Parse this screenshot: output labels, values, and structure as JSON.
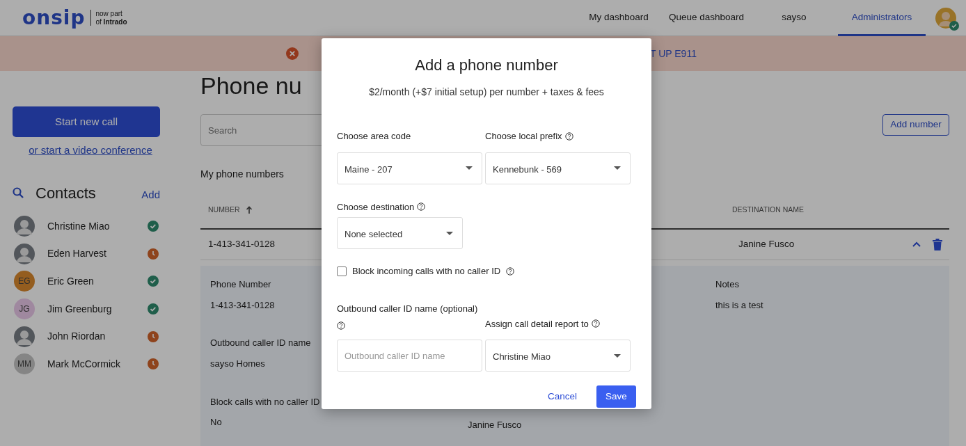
{
  "header": {
    "logo": "onsip",
    "tagline": [
      "now part",
      "of **Intrado**"
    ],
    "nav": [
      {
        "label": "My dashboard",
        "selected": false
      },
      {
        "label": "Queue dashboard",
        "selected": false
      },
      {
        "label": "sayso",
        "selected": false
      },
      {
        "label": "Administrators",
        "selected": true
      }
    ],
    "user_available": true
  },
  "banner": {
    "link": "T UP E911"
  },
  "sidebar": {
    "start_call": "Start new call",
    "video_link": "or start a video conference",
    "contacts_title": "Contacts",
    "add": "Add",
    "contacts": [
      {
        "name": "Christine Miao",
        "avatar": {
          "kind": "photo"
        },
        "available": true
      },
      {
        "name": "Eden Harvest",
        "avatar": {
          "kind": "photo"
        },
        "available": false
      },
      {
        "name": "Eric Green",
        "avatar": {
          "kind": "initials",
          "text": "EG",
          "color": "#945e20"
        },
        "available": true
      },
      {
        "name": "Jim Greenburg",
        "avatar": {
          "kind": "initials",
          "text": "JG",
          "color": "#a0899f"
        },
        "available": true
      },
      {
        "name": "John Riordan",
        "avatar": {
          "kind": "photo"
        },
        "available": false
      },
      {
        "name": "Mark McCormick",
        "avatar": {
          "kind": "initials",
          "text": "MM",
          "color": "#858585"
        },
        "available": false
      }
    ]
  },
  "main": {
    "title": "Phone nu",
    "search": {
      "placeholder": "Search"
    },
    "add_button": "Add number",
    "section_title": "My phone numbers",
    "table": {
      "columns": [
        {
          "label": "NUMBER",
          "sort_ascending": true
        },
        {
          "label": "DESTINATION NAME"
        }
      ],
      "rows": [
        {
          "cells": [
            "1-413-341-0128",
            "Janine Fusco"
          ],
          "expanded": true
        }
      ]
    },
    "details": [
      {
        "label": "Phone Number",
        "value": "1-413-341-0128"
      },
      {
        "label": "Outbound caller ID name",
        "value": "sayso Homes"
      },
      {
        "label": "Block calls with no caller ID",
        "value": "No"
      }
    ],
    "details_col2": {
      "value": "Janine Fusco"
    },
    "notes": {
      "label": "Notes",
      "value": "this is a test"
    }
  },
  "modal": {
    "title": "Add a phone number",
    "subtitle": "$2/month (+$7 initial setup) per number + taxes & fees",
    "area_code": {
      "label": "Choose area code",
      "value": "Maine - 207"
    },
    "local_prefix": {
      "label": "Choose local prefix",
      "value": "Kennebunk - 569"
    },
    "destination": {
      "label": "Choose destination",
      "value": "None selected"
    },
    "block_checkbox": {
      "label": "Block incoming calls with no caller ID",
      "checked": false
    },
    "caller_id": {
      "label": "Outbound caller ID name (optional)",
      "placeholder": "Outbound caller ID name"
    },
    "report": {
      "label": "Assign call detail report to",
      "value": "Christine Miao"
    },
    "cancel": "Cancel",
    "save": "Save"
  }
}
